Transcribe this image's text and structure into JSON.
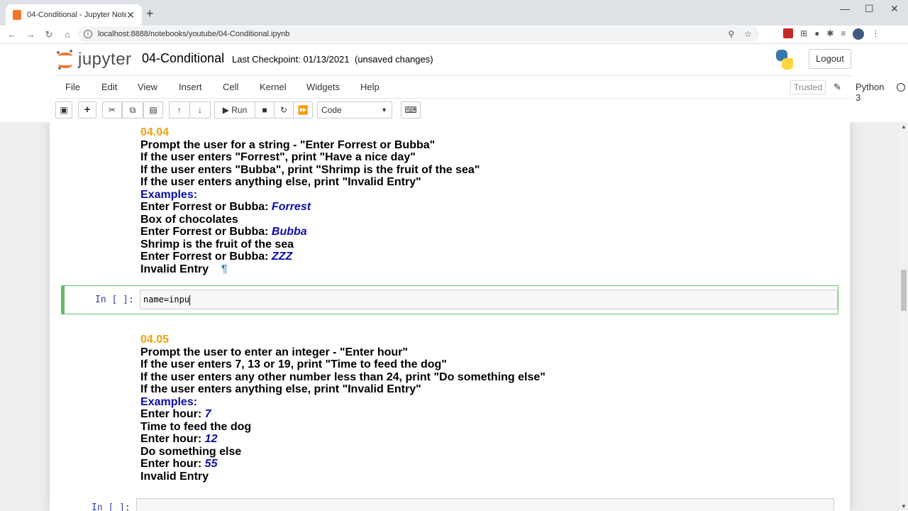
{
  "browser": {
    "tab_title": "04-Conditional - Jupyter Notebook",
    "url": "localhost:8888/notebooks/youtube/04-Conditional.ipynb"
  },
  "header": {
    "logo_text": "jupyter",
    "notebook_title": "04-Conditional",
    "checkpoint": "Last Checkpoint: 01/13/2021",
    "unsaved": "(unsaved changes)",
    "logout": "Logout"
  },
  "menu": {
    "items": [
      "File",
      "Edit",
      "View",
      "Insert",
      "Cell",
      "Kernel",
      "Widgets",
      "Help"
    ],
    "trusted": "Trusted",
    "kernel": "Python 3"
  },
  "toolbar": {
    "run_label": "Run",
    "cell_type": "Code"
  },
  "cells": {
    "md1": {
      "heading": "04.04",
      "lines": [
        "Prompt the user for a string - \"Enter Forrest or Bubba\"",
        "If the user enters \"Forrest\", print \"Have a nice day\"",
        "If the user enters \"Bubba\", print \"Shrimp is the fruit of the sea\"",
        "If the user enters anything else, print \"Invalid Entry\""
      ],
      "examples_label": "Examples:",
      "prompt_text": "Enter Forrest or Bubba:",
      "ex1_input": "Forrest",
      "ex1_output": "Box of chocolates",
      "ex2_input": "Bubba",
      "ex2_output": "Shrimp is the fruit of the sea",
      "ex3_input": "ZZZ",
      "ex3_output": "Invalid Entry",
      "pilcrow": "¶"
    },
    "code1": {
      "prompt": "In [ ]:",
      "code": "name=inpu"
    },
    "md2": {
      "heading": "04.05",
      "lines": [
        "Prompt the user to enter an integer - \"Enter hour\"",
        "If the user enters 7, 13 or 19, print \"Time to feed the dog\"",
        "If the user enters any other number less than 24, print \"Do something else\"",
        "If the user enters anything else, print \"Invalid Entry\""
      ],
      "examples_label": "Examples:",
      "prompt_text": "Enter hour:",
      "ex1_input": "7",
      "ex1_output": "Time to feed the dog",
      "ex2_input": "12",
      "ex2_output": "Do something else",
      "ex3_input": "55",
      "ex3_output": "Invalid Entry"
    },
    "code2": {
      "prompt": "In [ ]:"
    }
  }
}
